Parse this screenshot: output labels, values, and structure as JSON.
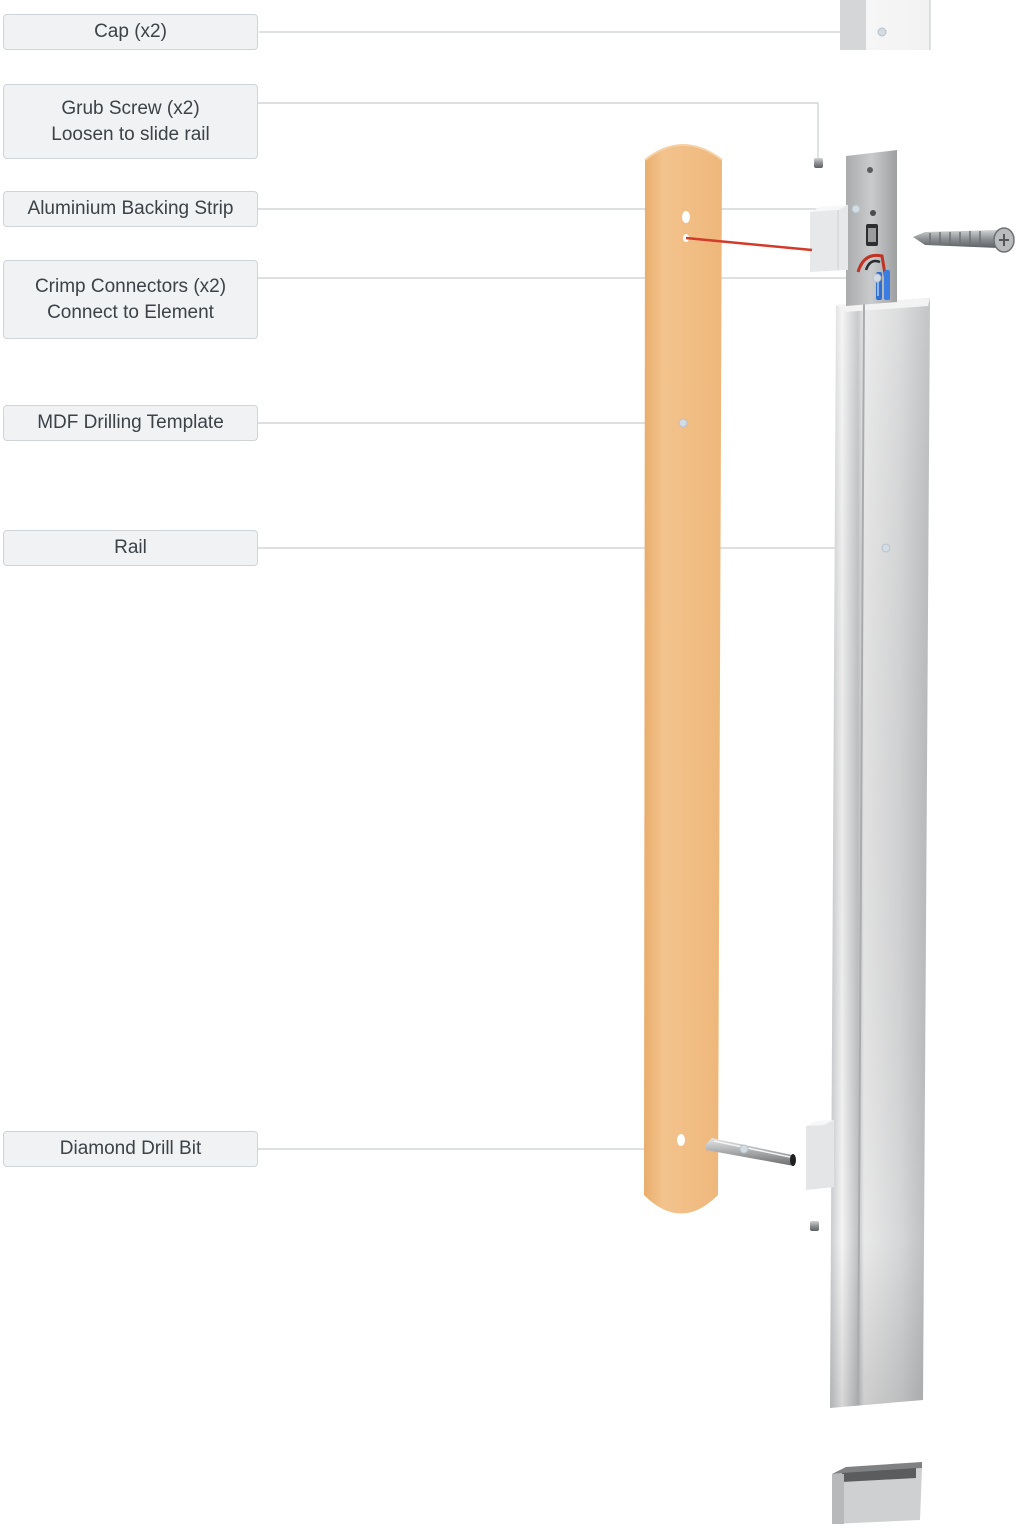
{
  "labels": {
    "cap": "Cap (x2)",
    "grub_screw": "Grub Screw (x2)",
    "grub_screw_note": "Loosen to slide rail",
    "backing_strip": "Aluminium Backing Strip",
    "crimp_connectors": "Crimp Connectors (x2)",
    "crimp_connectors_note": "Connect to Element",
    "drilling_template": "MDF Drilling Template",
    "rail": "Rail",
    "drill_bit": "Diamond Drill Bit"
  },
  "colors": {
    "label_bg": "#f0f2f4",
    "label_border": "#cfd4d9",
    "leader_line": "#c9ced3",
    "template_fill": "#f0bd82",
    "rail_fill": "#dcdcdc",
    "wire_red": "#d23a2a",
    "wire_blue": "#2f6fd0"
  }
}
